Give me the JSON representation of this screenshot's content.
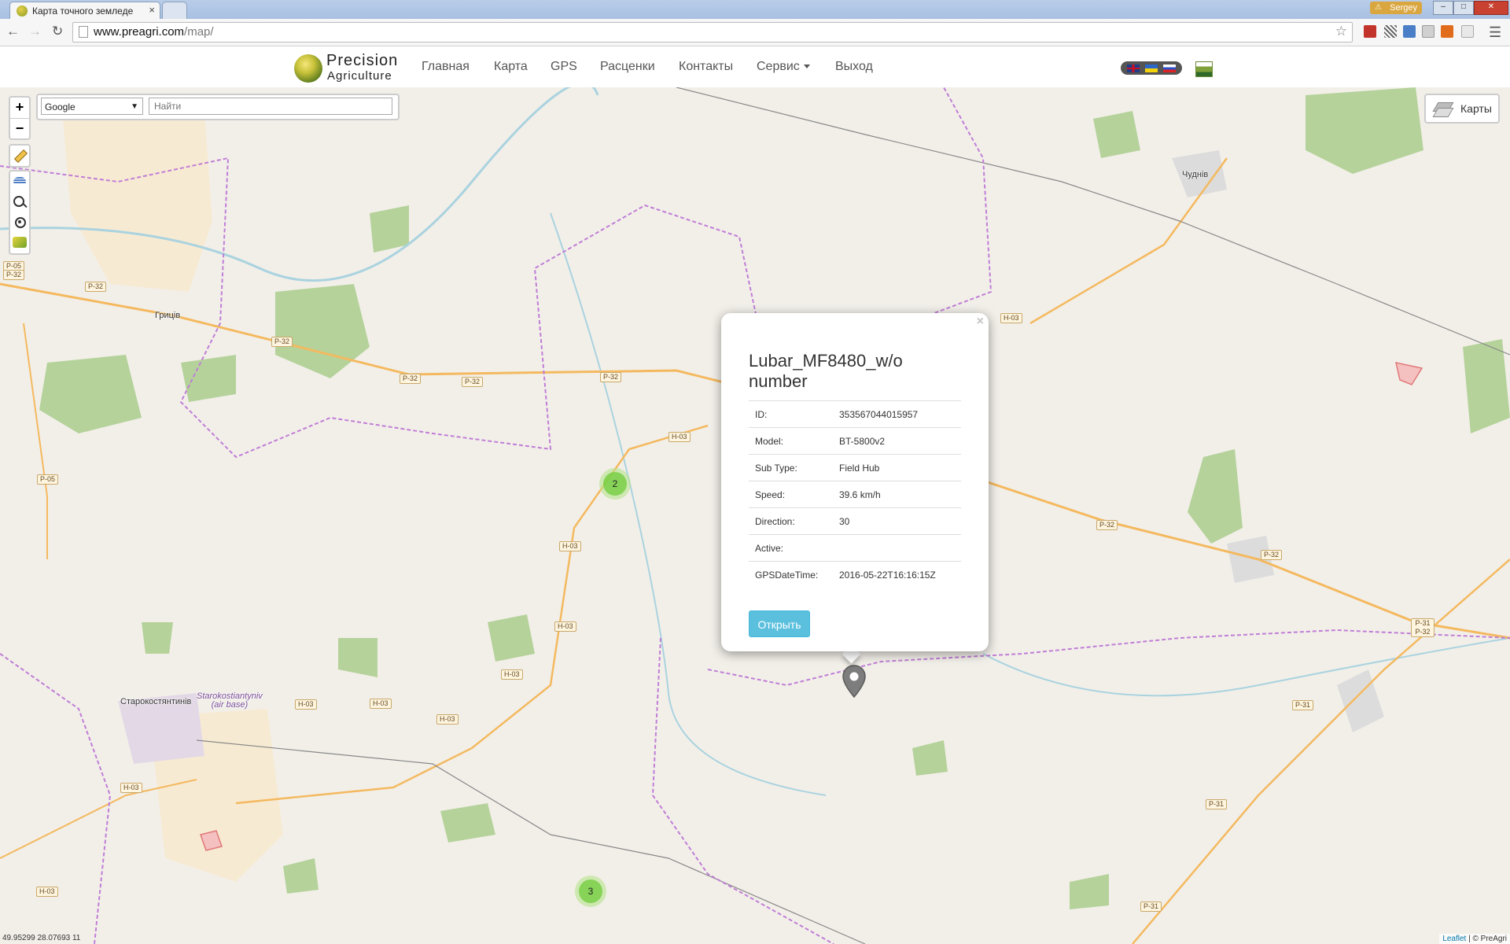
{
  "browser": {
    "tab_title": "Карта точного земледе",
    "profile_name": "Sergey",
    "url_host": "www.preagri.com",
    "url_path": "/map/"
  },
  "site": {
    "brand_line1": "Precision",
    "brand_line2": "Agriculture",
    "nav": {
      "home": "Главная",
      "map": "Карта",
      "gps": "GPS",
      "prices": "Расценки",
      "contacts": "Контакты",
      "service": "Сервис",
      "logout": "Выход"
    },
    "languages": [
      "en",
      "ua",
      "ru"
    ]
  },
  "map": {
    "provider_selected": "Google",
    "search_placeholder": "Найти",
    "layers_label": "Карты",
    "zoom_in": "+",
    "zoom_out": "−",
    "coordinates_readout": "49.95299 28.07693 11",
    "attribution_link": "Leaflet",
    "attribution_text": " | © PreAgri",
    "places": {
      "hrytsiv": "Гриців",
      "chudniv": "Чуднів",
      "starokostiantyniv": "Старокостянтинів",
      "airbase_line1": "Starokostiantyniv",
      "airbase_line2": "(air base)"
    },
    "road_labels": {
      "p05a": "P-05",
      "p32a": "P-32",
      "p32b": "P-32",
      "p32c": "P-32",
      "p32d": "P-32",
      "p32e": "P-32",
      "p32f": "P-32",
      "p32g": "P-32",
      "p05b": "P-05",
      "h03a": "H-03",
      "h03b": "H-03",
      "h03c": "H-03",
      "h03d": "H-03",
      "h03e": "H-03",
      "h03f": "H-03",
      "h03g": "H-03",
      "h03h": "H-03",
      "h03i": "H-03",
      "h03j": "H-03",
      "h03k": "H-03",
      "p31a": "P-31",
      "p31b": "P-31",
      "p31c": "P-31",
      "p31d": "P-31",
      "p31p32": "P-31 P-32"
    },
    "clusters": [
      {
        "label": "2"
      },
      {
        "label": "3"
      }
    ],
    "colors": {
      "cluster_fill": "#6ecc39",
      "boundary": "#c07ed6",
      "road": "#f4b95f",
      "forest": "#b5d29a",
      "water": "#aad3df",
      "button_info": "#5bc0de"
    }
  },
  "popup": {
    "title": "Lubar_MF8480_w/o number",
    "close": "×",
    "rows": [
      {
        "key": "ID:",
        "value": "353567044015957"
      },
      {
        "key": "Model:",
        "value": "BT-5800v2"
      },
      {
        "key": "Sub Type:",
        "value": "Field Hub"
      },
      {
        "key": "Speed:",
        "value": "39.6 km/h"
      },
      {
        "key": "Direction:",
        "value": "30"
      },
      {
        "key": "Active:",
        "value": ""
      },
      {
        "key": "GPSDateTime:",
        "value": "2016-05-22T16:16:15Z"
      }
    ],
    "open_button": "Открыть"
  }
}
